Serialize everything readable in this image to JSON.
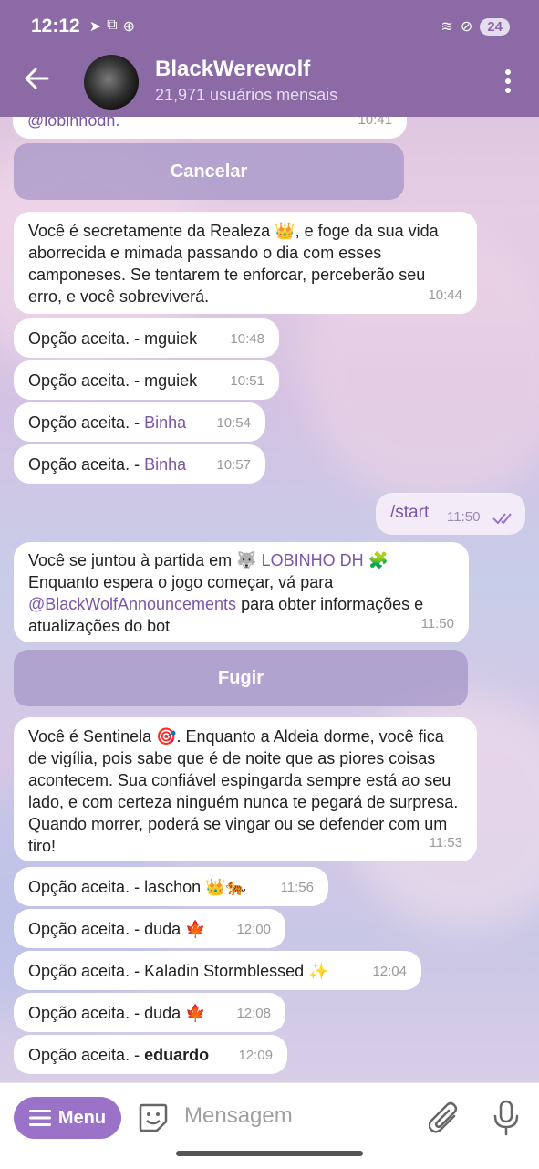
{
  "status_bar": {
    "time": "12:12",
    "battery": "24"
  },
  "header": {
    "title": "BlackWerewolf",
    "subtitle": "21,971 usuários mensais"
  },
  "messages": {
    "top_partial": "@lobinhodh.",
    "top_time": "10:41",
    "cancel_button": "Cancelar",
    "m1_text": "Você é secretamente da Realeza 👑, e foge da sua vida aborrecida e mimada passando o dia com esses camponeses. Se tentarem te enforcar, perceberão seu erro, e você sobreviverá.",
    "m1_time": "10:44",
    "prefix": "Opção aceita. - ",
    "m2_name": "mguiek",
    "m2_time": "10:48",
    "m3_name": "mguiek",
    "m3_time": "10:51",
    "m4_name": "Binha",
    "m4_time": "10:54",
    "m5_name": "Binha",
    "m5_time": "10:57",
    "out_text": "/start",
    "out_time": "11:50",
    "join_line1": "Você se juntou à partida em ",
    "join_group": "🐺 LOBINHO DH 🧩",
    "join_line2": "Enquanto espera o jogo começar, vá para",
    "join_link": "@BlackWolfAnnouncements",
    "join_line3": " para obter informações e atualizações do bot",
    "join_time": "11:50",
    "flee_button": "Fugir",
    "m6_text": "Você é Sentinela 🎯. Enquanto a Aldeia dorme, você fica de vigília, pois sabe que é de noite que as piores coisas acontecem. Sua confiável espingarda sempre está ao seu lado, e com certeza ninguém nunca te pegará de surpresa. Quando morrer, poderá se vingar ou se defender com um tiro!",
    "m6_time": "11:53",
    "m7_name": "laschon 👑🐅",
    "m7_time": "11:56",
    "m8_name": "duda 🍁",
    "m8_time": "12:00",
    "m9_name": "Kaladin Stormblessed ✨",
    "m9_time": "12:04",
    "m10_name": "duda 🍁",
    "m10_time": "12:08",
    "m11_name": "eduardo",
    "m11_time": "12:09"
  },
  "input": {
    "menu_label": "Menu",
    "placeholder": "Mensagem"
  },
  "colors": {
    "header": "#8b6aa6",
    "accent": "#9a73c8",
    "link": "#7b55a6"
  }
}
